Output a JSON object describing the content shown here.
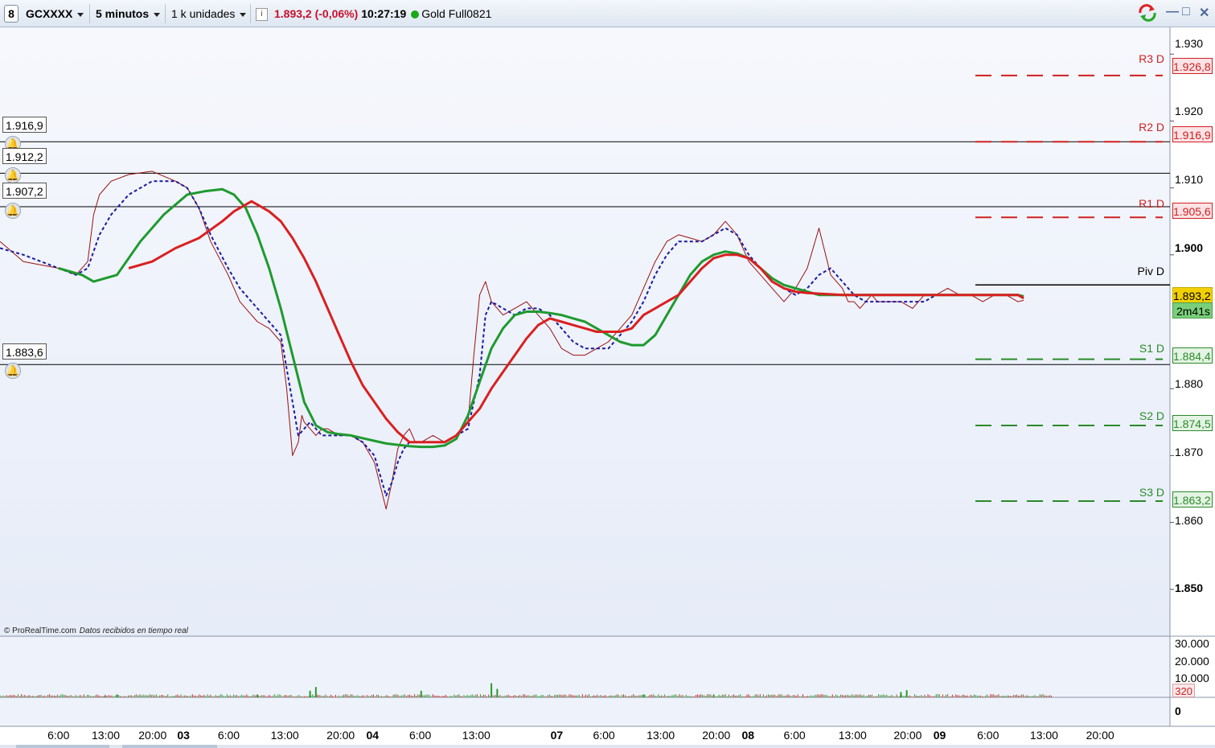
{
  "toolbar": {
    "logo": "8",
    "instrument": "GCXXXX",
    "timeframe": "5 minutos",
    "units": "1 k unidades",
    "info_icon": "info-icon",
    "last_price": "1.893,2 (-0,06%)",
    "time": "10:27:19",
    "contract": "Gold Full0821",
    "window_controls": [
      "—",
      "□",
      "✕"
    ]
  },
  "footer": {
    "source": "© ProRealTime.com",
    "status": "Datos recibidos en tiempo real"
  },
  "colors": {
    "background": "#eef2fb",
    "price_line": "#9a1010",
    "fast_ma": "#1a1aa0",
    "medium_ma": "#1e9a2e",
    "slow_ma": "#d92020",
    "resistance": "#d02020",
    "support": "#2a8a2a",
    "current_price_box": "#f2d000",
    "timer_box": "#7ad07a"
  },
  "chart_data": {
    "type": "line",
    "title": "",
    "ylim": [
      1843,
      1934
    ],
    "y_ticks": [
      {
        "value": 1930,
        "label": "1.930"
      },
      {
        "value": 1920,
        "label": "1.920"
      },
      {
        "value": 1910,
        "label": "1.910"
      },
      {
        "value": 1900,
        "label": "1.900",
        "bold": true
      },
      {
        "value": 1880,
        "label": "1.880"
      },
      {
        "value": 1870,
        "label": "1.870"
      },
      {
        "value": 1860,
        "label": "1.860"
      },
      {
        "value": 1850,
        "label": "1.850",
        "bold": true
      }
    ],
    "x_labels": [
      {
        "label": "6:00",
        "pos": 0.05
      },
      {
        "label": "13:00",
        "pos": 0.0904
      },
      {
        "label": "20:00",
        "pos": 0.1304
      },
      {
        "label": "03",
        "pos": 0.1568,
        "bold": true
      },
      {
        "label": "6:00",
        "pos": 0.1955
      },
      {
        "label": "13:00",
        "pos": 0.2434
      },
      {
        "label": "20:00",
        "pos": 0.2912
      },
      {
        "label": "04",
        "pos": 0.3184,
        "bold": true
      },
      {
        "label": "6:00",
        "pos": 0.3592
      },
      {
        "label": "13:00",
        "pos": 0.4071
      },
      {
        "label": "07",
        "pos": 0.4759,
        "bold": true
      },
      {
        "label": "6:00",
        "pos": 0.5162
      },
      {
        "label": "13:00",
        "pos": 0.5647
      },
      {
        "label": "20:00",
        "pos": 0.6122
      },
      {
        "label": "08",
        "pos": 0.6394,
        "bold": true
      },
      {
        "label": "6:00",
        "pos": 0.6791
      },
      {
        "label": "13:00",
        "pos": 0.7287
      },
      {
        "label": "20:00",
        "pos": 0.7759
      },
      {
        "label": "09",
        "pos": 0.8031,
        "bold": true
      },
      {
        "label": "6:00",
        "pos": 0.8445
      },
      {
        "label": "13:00",
        "pos": 0.8924
      },
      {
        "label": "20:00",
        "pos": 0.9403
      }
    ],
    "price": {
      "x": [
        0,
        0.02,
        0.05,
        0.065,
        0.075,
        0.08,
        0.085,
        0.095,
        0.11,
        0.13,
        0.15,
        0.16,
        0.17,
        0.18,
        0.195,
        0.205,
        0.21,
        0.22,
        0.23,
        0.24,
        0.245,
        0.25,
        0.255,
        0.258,
        0.26,
        0.265,
        0.27,
        0.275,
        0.28,
        0.29,
        0.3,
        0.31,
        0.32,
        0.33,
        0.335,
        0.34,
        0.345,
        0.35,
        0.355,
        0.36,
        0.37,
        0.38,
        0.39,
        0.4,
        0.405,
        0.41,
        0.415,
        0.42,
        0.43,
        0.44,
        0.45,
        0.46,
        0.47,
        0.48,
        0.49,
        0.5,
        0.51,
        0.52,
        0.53,
        0.54,
        0.55,
        0.56,
        0.57,
        0.58,
        0.59,
        0.6,
        0.61,
        0.62,
        0.63,
        0.64,
        0.65,
        0.655,
        0.66,
        0.665,
        0.67,
        0.68,
        0.69,
        0.7,
        0.71,
        0.72,
        0.725,
        0.73,
        0.735,
        0.74,
        0.745,
        0.75,
        0.76,
        0.77,
        0.78,
        0.79,
        0.8,
        0.81,
        0.82,
        0.83,
        0.84,
        0.85,
        0.86,
        0.87,
        0.875
      ],
      "y": [
        1902,
        1899,
        1898,
        1897,
        1899,
        1906,
        1909,
        1911,
        1912,
        1912.5,
        1911,
        1910,
        1907,
        1902,
        1897,
        1893,
        1892,
        1890,
        1889,
        1887,
        1880,
        1870,
        1872,
        1876,
        1875,
        1874,
        1873,
        1874,
        1874,
        1873,
        1873,
        1872,
        1869,
        1862,
        1866,
        1871,
        1873,
        1874,
        1872,
        1872,
        1873,
        1872,
        1873,
        1875,
        1885,
        1894,
        1896,
        1893,
        1891,
        1892,
        1893,
        1891,
        1889,
        1886,
        1885,
        1885,
        1886,
        1887,
        1889,
        1891,
        1895,
        1899,
        1902,
        1903,
        1902.5,
        1902,
        1903,
        1905,
        1903,
        1899,
        1897,
        1896,
        1895,
        1894,
        1893,
        1895,
        1898,
        1904,
        1897,
        1895,
        1893,
        1893,
        1892,
        1893,
        1894,
        1893,
        1893,
        1893,
        1892,
        1894,
        1894,
        1895,
        1894,
        1894,
        1893,
        1894,
        1894,
        1893,
        1893.2
      ]
    },
    "sma_fast": {
      "x": [
        0,
        0.02,
        0.05,
        0.065,
        0.075,
        0.085,
        0.095,
        0.11,
        0.13,
        0.15,
        0.16,
        0.17,
        0.18,
        0.195,
        0.205,
        0.215,
        0.225,
        0.24,
        0.25,
        0.255,
        0.26,
        0.265,
        0.27,
        0.275,
        0.28,
        0.29,
        0.3,
        0.31,
        0.32,
        0.33,
        0.335,
        0.34,
        0.345,
        0.35,
        0.355,
        0.36,
        0.37,
        0.38,
        0.39,
        0.4,
        0.41,
        0.415,
        0.42,
        0.43,
        0.44,
        0.45,
        0.46,
        0.47,
        0.48,
        0.49,
        0.5,
        0.51,
        0.52,
        0.53,
        0.54,
        0.55,
        0.56,
        0.57,
        0.58,
        0.59,
        0.6,
        0.61,
        0.62,
        0.63,
        0.64,
        0.65,
        0.66,
        0.67,
        0.68,
        0.69,
        0.7,
        0.71,
        0.72,
        0.73,
        0.74,
        0.75,
        0.76,
        0.77,
        0.78,
        0.79,
        0.8,
        0.81,
        0.82,
        0.83,
        0.84,
        0.85,
        0.86,
        0.87,
        0.875
      ],
      "y": [
        1901,
        1900,
        1898,
        1897,
        1898,
        1903,
        1906,
        1909,
        1911,
        1911,
        1910,
        1907,
        1903,
        1898,
        1895,
        1893,
        1891,
        1888,
        1878,
        1873,
        1874,
        1875,
        1874,
        1873,
        1873,
        1873,
        1873,
        1872,
        1870,
        1864,
        1866,
        1869,
        1871,
        1872,
        1872,
        1872,
        1872,
        1872,
        1873,
        1874,
        1882,
        1891,
        1893,
        1892,
        1891,
        1892,
        1892,
        1891,
        1889,
        1887,
        1886,
        1886,
        1886,
        1888,
        1890,
        1893,
        1897,
        1900,
        1902,
        1902,
        1902,
        1903,
        1904,
        1903,
        1900,
        1898,
        1896,
        1895,
        1894,
        1895,
        1897,
        1898,
        1896,
        1894,
        1893,
        1893,
        1893,
        1893,
        1893,
        1893,
        1894,
        1894,
        1894,
        1894,
        1894,
        1894,
        1894,
        1894,
        1893.5
      ]
    },
    "sma_medium": {
      "x": [
        0.05,
        0.07,
        0.08,
        0.1,
        0.12,
        0.14,
        0.16,
        0.175,
        0.19,
        0.2,
        0.21,
        0.22,
        0.23,
        0.24,
        0.25,
        0.26,
        0.27,
        0.28,
        0.29,
        0.3,
        0.31,
        0.32,
        0.33,
        0.34,
        0.35,
        0.36,
        0.37,
        0.38,
        0.39,
        0.4,
        0.41,
        0.42,
        0.43,
        0.44,
        0.45,
        0.46,
        0.47,
        0.48,
        0.49,
        0.5,
        0.51,
        0.52,
        0.53,
        0.54,
        0.55,
        0.56,
        0.57,
        0.58,
        0.59,
        0.6,
        0.61,
        0.62,
        0.63,
        0.64,
        0.65,
        0.66,
        0.67,
        0.68,
        0.69,
        0.7,
        0.71,
        0.72,
        0.73,
        0.74,
        0.75,
        0.76,
        0.77,
        0.78,
        0.79,
        0.8,
        0.81,
        0.82,
        0.83,
        0.84,
        0.85,
        0.86,
        0.87,
        0.875
      ],
      "y": [
        1898,
        1897,
        1896,
        1897,
        1902,
        1906,
        1909,
        1909.5,
        1909.8,
        1909,
        1907,
        1903,
        1898,
        1892,
        1885,
        1878,
        1874.5,
        1873.5,
        1873.2,
        1873,
        1872.6,
        1872.2,
        1871.8,
        1871.6,
        1871.4,
        1871.3,
        1871.3,
        1871.5,
        1872.5,
        1876,
        1881,
        1886,
        1889,
        1891,
        1891.5,
        1891.5,
        1891.3,
        1891,
        1890.5,
        1890,
        1889,
        1888,
        1887,
        1886.5,
        1886.5,
        1888,
        1891,
        1894,
        1897,
        1899,
        1900,
        1900.5,
        1900.2,
        1899.5,
        1898,
        1896.5,
        1895.5,
        1895,
        1894.5,
        1894,
        1894,
        1894,
        1894,
        1894,
        1894,
        1894,
        1894,
        1894,
        1894,
        1894,
        1894,
        1894,
        1894,
        1894,
        1894,
        1894,
        1894,
        1893.8
      ]
    },
    "sma_slow": {
      "x": [
        0.11,
        0.13,
        0.15,
        0.17,
        0.19,
        0.2,
        0.21,
        0.215,
        0.22,
        0.23,
        0.24,
        0.25,
        0.26,
        0.27,
        0.28,
        0.29,
        0.3,
        0.31,
        0.32,
        0.33,
        0.34,
        0.35,
        0.36,
        0.37,
        0.38,
        0.39,
        0.4,
        0.41,
        0.42,
        0.43,
        0.44,
        0.45,
        0.46,
        0.47,
        0.48,
        0.49,
        0.5,
        0.51,
        0.52,
        0.53,
        0.54,
        0.55,
        0.56,
        0.57,
        0.58,
        0.59,
        0.6,
        0.61,
        0.62,
        0.63,
        0.64,
        0.65,
        0.66,
        0.67,
        0.68,
        0.69,
        0.7,
        0.71,
        0.72,
        0.73,
        0.74,
        0.75,
        0.76,
        0.77,
        0.78,
        0.79,
        0.8,
        0.81,
        0.82,
        0.83,
        0.84,
        0.85,
        0.86,
        0.87,
        0.875
      ],
      "y": [
        1898,
        1899,
        1901,
        1902.5,
        1905,
        1906.5,
        1907.5,
        1908,
        1907.5,
        1906.5,
        1905,
        1902.5,
        1899.5,
        1896,
        1892,
        1888,
        1884,
        1880.5,
        1878,
        1875.5,
        1873.5,
        1872,
        1872,
        1872,
        1872,
        1873,
        1875,
        1877,
        1880,
        1882.5,
        1885,
        1887.5,
        1889.5,
        1890.5,
        1890,
        1889.5,
        1889,
        1888.5,
        1888.5,
        1888.5,
        1889,
        1891,
        1892,
        1893,
        1894,
        1896,
        1898,
        1899.5,
        1900,
        1900,
        1899.5,
        1898,
        1896,
        1895,
        1894.5,
        1894.3,
        1894.2,
        1894.1,
        1894,
        1894,
        1894,
        1894,
        1894,
        1894,
        1894,
        1894,
        1894,
        1894,
        1894,
        1894,
        1894,
        1894,
        1894,
        1894,
        1893.5
      ]
    },
    "horizontal_lines": [
      {
        "label": "1.916,9",
        "value": 1916.9
      },
      {
        "label": "1.912,2",
        "value": 1912.2
      },
      {
        "label": "1.907,2",
        "value": 1907.2
      },
      {
        "label": "1.883,6",
        "value": 1883.6
      }
    ],
    "pivots": [
      {
        "name": "R3 D",
        "label": "1.926,8",
        "value": 1926.8,
        "kind": "resistance"
      },
      {
        "name": "R2 D",
        "label": "1.916,9",
        "value": 1916.9,
        "kind": "resistance"
      },
      {
        "name": "R1 D",
        "label": "1.905,6",
        "value": 1905.6,
        "kind": "resistance"
      },
      {
        "name": "Piv D",
        "value": 1895.5,
        "kind": "pivot"
      },
      {
        "name": "S1 D",
        "label": "1.884,4",
        "value": 1884.4,
        "kind": "support"
      },
      {
        "name": "S2 D",
        "label": "1.874,5",
        "value": 1874.5,
        "kind": "support"
      },
      {
        "name": "S3 D",
        "label": "1.863,2",
        "value": 1863.2,
        "kind": "support"
      }
    ],
    "current_price": {
      "label": "1.893,2",
      "value": 1893.2
    },
    "timer": "2m41s",
    "volume": {
      "type": "bar",
      "y_ticks": [
        "30.000",
        "20.000",
        "10.000"
      ],
      "current_label": "320",
      "spikes": [
        {
          "pos": 0.09,
          "value": 800
        },
        {
          "pos": 0.1,
          "value": 1500
        },
        {
          "pos": 0.22,
          "value": 1500
        },
        {
          "pos": 0.265,
          "value": 3500
        },
        {
          "pos": 0.27,
          "value": 5500
        },
        {
          "pos": 0.36,
          "value": 3500
        },
        {
          "pos": 0.42,
          "value": 7500
        },
        {
          "pos": 0.425,
          "value": 4500
        },
        {
          "pos": 0.55,
          "value": 1500
        },
        {
          "pos": 0.61,
          "value": 1500
        },
        {
          "pos": 0.77,
          "value": 2800
        },
        {
          "pos": 0.775,
          "value": 3800
        }
      ]
    },
    "oscillator": {
      "zero_label": "0"
    }
  }
}
